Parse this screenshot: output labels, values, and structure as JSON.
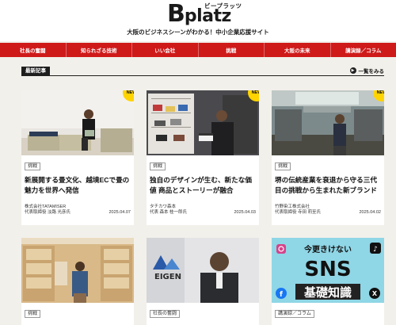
{
  "site": {
    "logo_b": "B",
    "logo_rest": "platz",
    "logo_kana": "ビープラッツ",
    "tagline": "大阪のビジネスシーンがわかる！中小企業応援サイト"
  },
  "nav": [
    "社長の奮闘",
    "知られざる技術",
    "いい会社",
    "挑戦",
    "大阪の未来",
    "講演録／コラム"
  ],
  "section": {
    "title": "最新記事",
    "more_label": "一覧をみる",
    "more_icon": "arrow-right-icon"
  },
  "articles": [
    {
      "badge": "NEW",
      "category": "挑戦",
      "title": "新展開する畳文化、越境ECで畳の魅力を世界へ発信",
      "company": "株式会社TATAMISER",
      "person": "代表取締役 淡路 光彦氏",
      "date": "2025.04.07"
    },
    {
      "badge": "NEW",
      "category": "挑戦",
      "title": "独自のデザインが生む、新たな価値 商品とストーリーが融合",
      "company": "タチカワ森本",
      "person": "代表 森本 桂一郎氏",
      "date": "2025.04.03"
    },
    {
      "badge": "NEW",
      "category": "挑戦",
      "title": "堺の伝統産業を衰退から守る三代目の挑戦から生まれた新ブランド",
      "company": "竹野染工株式会社",
      "person": "代表取締役 寺田 莉至氏",
      "date": "2025.04.02"
    },
    {
      "category": "挑戦",
      "title": "",
      "company": "",
      "person": "",
      "date": ""
    },
    {
      "category": "社長の奮闘",
      "title": "",
      "company": "",
      "person": "",
      "date": "",
      "logo_text": "EIGEN"
    },
    {
      "category": "講演録／コラム",
      "title": "",
      "company": "",
      "person": "",
      "date": "",
      "image_text_1": "今更きけない",
      "image_text_2": "SNS",
      "image_text_3": "基礎知識"
    }
  ],
  "colors": {
    "nav_red": "#cf1a1a",
    "badge_yellow": "#ffd400",
    "sns_bg": "#7fd3e6"
  }
}
